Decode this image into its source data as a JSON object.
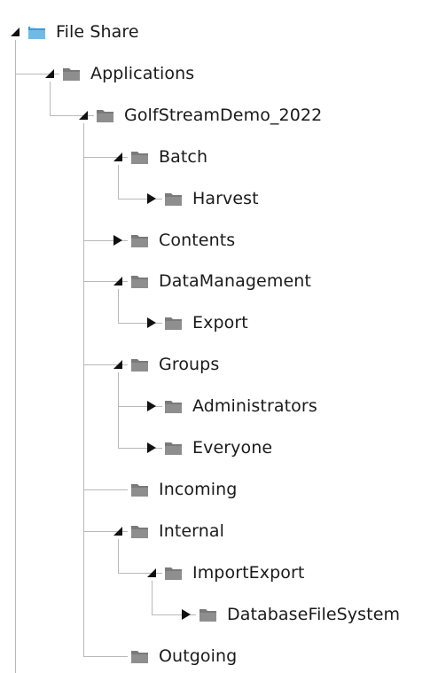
{
  "tree": {
    "accent_color": "#3a9bd8",
    "folder_color": "#7a7a7a",
    "nodes": [
      {
        "label": "File Share",
        "depth": 0,
        "expander": "expanded",
        "icon": "share-folder-icon"
      },
      {
        "label": "Applications",
        "depth": 1,
        "expander": "expanded",
        "icon": "folder-icon"
      },
      {
        "label": "GolfStreamDemo_2022",
        "depth": 2,
        "expander": "expanded",
        "icon": "folder-icon"
      },
      {
        "label": "Batch",
        "depth": 3,
        "expander": "expanded",
        "icon": "folder-icon"
      },
      {
        "label": "Harvest",
        "depth": 4,
        "expander": "collapsed",
        "icon": "folder-icon"
      },
      {
        "label": "Contents",
        "depth": 3,
        "expander": "collapsed",
        "icon": "folder-icon"
      },
      {
        "label": "DataManagement",
        "depth": 3,
        "expander": "expanded",
        "icon": "folder-icon"
      },
      {
        "label": "Export",
        "depth": 4,
        "expander": "collapsed",
        "icon": "folder-icon"
      },
      {
        "label": "Groups",
        "depth": 3,
        "expander": "expanded",
        "icon": "folder-icon"
      },
      {
        "label": "Administrators",
        "depth": 4,
        "expander": "collapsed",
        "icon": "folder-icon"
      },
      {
        "label": "Everyone",
        "depth": 4,
        "expander": "collapsed",
        "icon": "folder-icon"
      },
      {
        "label": "Incoming",
        "depth": 3,
        "expander": "none",
        "icon": "folder-icon"
      },
      {
        "label": "Internal",
        "depth": 3,
        "expander": "expanded",
        "icon": "folder-icon"
      },
      {
        "label": "ImportExport",
        "depth": 4,
        "expander": "expanded",
        "icon": "folder-icon"
      },
      {
        "label": "DatabaseFileSystem",
        "depth": 5,
        "expander": "collapsed",
        "icon": "folder-icon"
      },
      {
        "label": "Outgoing",
        "depth": 3,
        "expander": "none",
        "icon": "folder-icon"
      }
    ]
  }
}
